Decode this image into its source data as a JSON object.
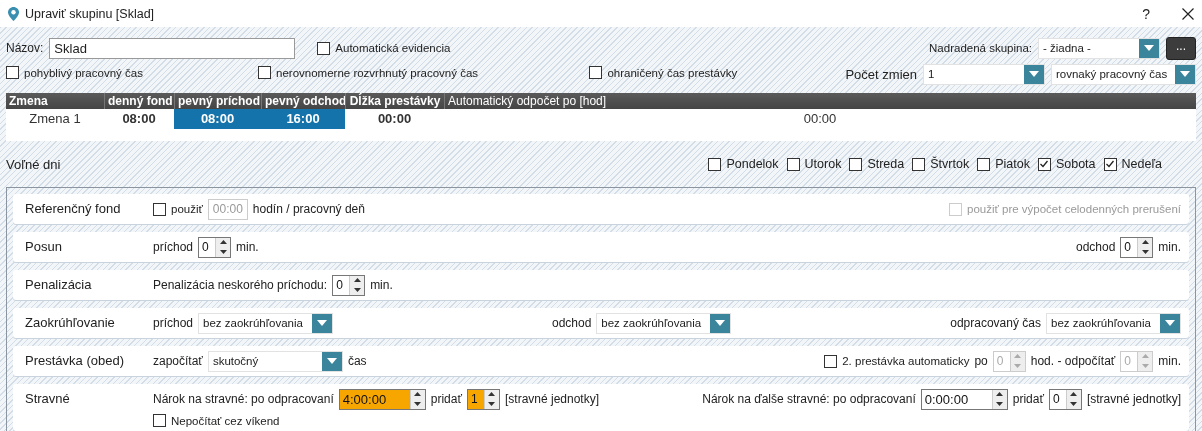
{
  "window": {
    "title": "Upraviť skupinu [Sklad]",
    "help": "?"
  },
  "header": {
    "name_label": "Názov:",
    "name_value": "Sklad",
    "auto_checkbox": {
      "label": "Automatická evidencia",
      "checked": false
    },
    "parent_label": "Nadradená skupina:",
    "parent_value": "- žiadna -",
    "more_button": "...",
    "options": [
      {
        "label": "pohyblivý pracovný čas",
        "checked": false
      },
      {
        "label": "nerovnomerne rozvrhnutý pracovný čas",
        "checked": false
      },
      {
        "label": "ohraničený čas prestávky",
        "checked": false
      }
    ],
    "shift_count_label": "Počet zmien",
    "shift_count_value": "1",
    "shift_mode_value": "rovnaký pracovný čas"
  },
  "shifts": {
    "columns": [
      "Zmena",
      "denný fond",
      "pevný príchod",
      "pevný odchod",
      "Dĺžka prestávky",
      "Automatický odpočet po [hod]"
    ],
    "rows": [
      {
        "cells": [
          {
            "text": "Zmena 1",
            "highlighted": false
          },
          {
            "text": "08:00",
            "highlighted": false
          },
          {
            "text": "08:00",
            "highlighted": true
          },
          {
            "text": "16:00",
            "highlighted": true
          },
          {
            "text": "00:00",
            "highlighted": false
          },
          {
            "text": "00:00",
            "highlighted": false
          }
        ]
      }
    ]
  },
  "free_days": {
    "label": "Voľné dni",
    "days": [
      {
        "label": "Pondelok",
        "checked": false
      },
      {
        "label": "Utorok",
        "checked": false
      },
      {
        "label": "Streda",
        "checked": false
      },
      {
        "label": "Štvrtok",
        "checked": false
      },
      {
        "label": "Piatok",
        "checked": false
      },
      {
        "label": "Sobota",
        "checked": true
      },
      {
        "label": "Nedeľa",
        "checked": true
      }
    ]
  },
  "sections": [
    {
      "title": "Referenčný fond",
      "groups": [
        [
          {
            "kind": "checkbox",
            "label": "použiť",
            "checked": false,
            "disabled": false
          },
          {
            "kind": "field",
            "value": "00:00",
            "disabled": true
          },
          {
            "kind": "text",
            "text": "hodín / pracovný deň"
          }
        ],
        [
          {
            "kind": "checkbox",
            "label": "použiť pre výpočet celodenných prerušení",
            "checked": false,
            "disabled": true
          }
        ]
      ]
    },
    {
      "title": "Posun",
      "groups": [
        [
          {
            "kind": "text",
            "text": "príchod"
          },
          {
            "kind": "spin",
            "value": "0",
            "disabled": false,
            "highlighted": false
          },
          {
            "kind": "text",
            "text": "min."
          }
        ],
        [
          {
            "kind": "text",
            "text": "odchod"
          },
          {
            "kind": "spin",
            "value": "0",
            "disabled": false,
            "highlighted": false
          },
          {
            "kind": "text",
            "text": "min."
          }
        ]
      ]
    },
    {
      "title": "Penalizácia",
      "groups": [
        [
          {
            "kind": "text",
            "text": "Penalizácia neskorého príchodu:"
          },
          {
            "kind": "spin",
            "value": "0",
            "disabled": false,
            "highlighted": false
          },
          {
            "kind": "text",
            "text": "min."
          }
        ]
      ]
    },
    {
      "title": "Zaokrúhľovanie",
      "groups": [
        [
          {
            "kind": "text",
            "text": "príchod"
          },
          {
            "kind": "select",
            "value": "bez zaokrúhľovania"
          }
        ],
        [
          {
            "kind": "text",
            "text": "odchod"
          },
          {
            "kind": "select",
            "value": "bez zaokrúhľovania"
          }
        ],
        [
          {
            "kind": "text",
            "text": "odpracovaný čas"
          },
          {
            "kind": "select",
            "value": "bez zaokrúhľovania"
          }
        ]
      ]
    },
    {
      "title": "Prestávka (obed)",
      "groups": [
        [
          {
            "kind": "text",
            "text": "započítať"
          },
          {
            "kind": "select",
            "value": "skutočný"
          },
          {
            "kind": "text",
            "text": "čas"
          }
        ],
        [
          {
            "kind": "checkbox",
            "label": "2. prestávka automaticky",
            "checked": false,
            "disabled": false
          },
          {
            "kind": "text",
            "text": "po"
          },
          {
            "kind": "spin",
            "value": "0",
            "disabled": true,
            "highlighted": false
          },
          {
            "kind": "text",
            "text": "hod. - odpočítať"
          },
          {
            "kind": "spin",
            "value": "0",
            "disabled": true,
            "highlighted": false
          },
          {
            "kind": "text",
            "text": "min."
          }
        ]
      ]
    },
    {
      "title": "Stravné",
      "groups": [
        [
          {
            "kind": "text",
            "text": "Nárok na stravné: po odpracovaní"
          },
          {
            "kind": "spin",
            "value": "4:00:00",
            "disabled": false,
            "highlighted": true
          },
          {
            "kind": "text",
            "text": "pridať"
          },
          {
            "kind": "spin",
            "value": "1",
            "disabled": false,
            "highlighted": true
          },
          {
            "kind": "text",
            "text": "[stravné jednotky]"
          }
        ],
        [
          {
            "kind": "text",
            "text": "Nárok na ďalše stravné: po odpracovaní"
          },
          {
            "kind": "spin",
            "value": "0:00:00",
            "disabled": false,
            "highlighted": false
          },
          {
            "kind": "text",
            "text": "pridať"
          },
          {
            "kind": "spin",
            "value": "0",
            "disabled": false,
            "highlighted": false
          },
          {
            "kind": "text",
            "text": "[stravné jednotky]"
          }
        ]
      ],
      "extra": [
        {
          "kind": "checkbox",
          "label": "Nepočítať cez víkend",
          "checked": false,
          "disabled": false
        }
      ]
    }
  ]
}
